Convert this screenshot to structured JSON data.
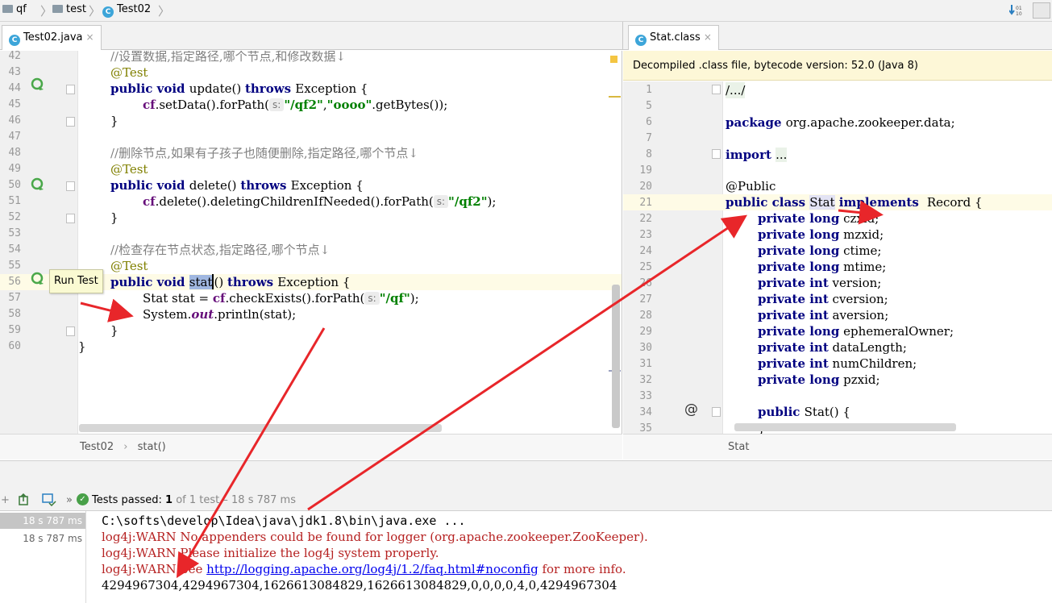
{
  "breadcrumb": {
    "items": [
      "qf",
      "test",
      "Test02"
    ]
  },
  "editor_left": {
    "tab": {
      "label": "Test02.java",
      "close": "×"
    },
    "line_numbers": [
      "42",
      "43",
      "44",
      "45",
      "46",
      "47",
      "48",
      "49",
      "50",
      "51",
      "52",
      "53",
      "54",
      "55",
      "56",
      "57",
      "58",
      "59",
      "60"
    ],
    "code": {
      "l42": "//设置数据,指定路径,哪个节点,和修改数据↓",
      "l43": "@Test",
      "l44_kw": "public void ",
      "l44_name": "update",
      "l44_mid": "() ",
      "l44_kw2": "throws ",
      "l44_rest": "Exception {",
      "l45_a": "cf",
      "l45_b": ".setData().forPath(",
      "l45_hint": "s:",
      "l45_str1": "\"/qf2\"",
      "l45_c": ",",
      "l45_str2": "\"oooo\"",
      "l45_d": ".getBytes());",
      "l46": "}",
      "l48": "//删除节点,如果有子孩子也随便删除,指定路径,哪个节点↓",
      "l49": "@Test",
      "l50_kw": "public void ",
      "l50_name": "delete",
      "l50_mid": "() ",
      "l50_kw2": "throws ",
      "l50_rest": "Exception {",
      "l51_a": "cf",
      "l51_b": ".delete().deletingChildrenIfNeeded().forPath(",
      "l51_hint": "s:",
      "l51_str": "\"/qf2\"",
      "l51_c": ");",
      "l52": "}",
      "l54": "//检查存在节点状态,指定路径,哪个节点↓",
      "l55": "@Test",
      "l56_kw": "public void ",
      "l56_name": "stat",
      "l56_mid": "() ",
      "l56_kw2": "throws ",
      "l56_rest": "Exception {",
      "l57_a": "Stat stat = ",
      "l57_b": "cf",
      "l57_c": ".checkExists().forPath(",
      "l57_hint": "s:",
      "l57_str": "\"/qf\"",
      "l57_d": ");",
      "l58_a": "System.",
      "l58_b": "out",
      "l58_c": ".println(stat);",
      "l59": "}",
      "l60": "}"
    },
    "tooltip": "Run Test",
    "crumbs": [
      "Test02",
      "stat()"
    ],
    "crumb_sep": "›"
  },
  "editor_right": {
    "tab": {
      "label": "Stat.class",
      "close": "×"
    },
    "banner": "Decompiled .class file, bytecode version: 52.0 (Java 8)",
    "line_numbers": [
      "1",
      "5",
      "6",
      "7",
      "8",
      "19",
      "20",
      "21",
      "22",
      "23",
      "24",
      "25",
      "26",
      "27",
      "28",
      "29",
      "30",
      "31",
      "32",
      "33",
      "34",
      "35"
    ],
    "code": {
      "l1": "/.../",
      "l6_kw": "package ",
      "l6_rest": "org.apache.zookeeper.data;",
      "l8_kw": "import ",
      "l8_rest": "...",
      "l20": "@Public",
      "l21_kw": "public class ",
      "l21_name": "Stat",
      "l21_kw2": " implements ",
      "l21_rest": "Record {",
      "fields": [
        {
          "type": "long",
          "name": "czxid;"
        },
        {
          "type": "long",
          "name": "mzxid;"
        },
        {
          "type": "long",
          "name": "ctime;"
        },
        {
          "type": "long",
          "name": "mtime;"
        },
        {
          "type": "int",
          "name": "version;"
        },
        {
          "type": "int",
          "name": "cversion;"
        },
        {
          "type": "int",
          "name": "aversion;"
        },
        {
          "type": "long",
          "name": "ephemeralOwner;"
        },
        {
          "type": "int",
          "name": "dataLength;"
        },
        {
          "type": "int",
          "name": "numChildren;"
        },
        {
          "type": "long",
          "name": "pzxid;"
        }
      ],
      "private_kw": "private ",
      "l34_kw": "public ",
      "l34_rest": "Stat() {",
      "l35": "}"
    },
    "at_marker": "@",
    "crumb": "Stat"
  },
  "run_panel": {
    "more": "»",
    "status_prefix": "Tests passed: ",
    "passed": "1",
    "status_rest": " of 1 test – 18 s 787 ms",
    "tree_items": [
      "18 s 787 ms",
      "18 s 787 ms"
    ],
    "console_lines": [
      "C:\\softs\\develop\\Idea\\java\\jdk1.8\\bin\\java.exe ...",
      "log4j:WARN No appenders could be found for logger (org.apache.zookeeper.ZooKeeper).",
      "log4j:WARN Please initialize the log4j system properly.",
      "4294967304,4294967304,1626613084829,1626613084829,0,0,0,0,4,0,4294967304"
    ],
    "warn_see_a": "log4j:WARN See ",
    "warn_see_url": "http://logging.apache.org/log4j/1.2/faq.html#noconfig",
    "warn_see_b": " for more info."
  },
  "colors": {
    "keyword": "#000080",
    "string": "#008000",
    "annotation": "#808000",
    "comment": "#808080",
    "warn": "#b62222",
    "arrow": "#e8262a"
  }
}
